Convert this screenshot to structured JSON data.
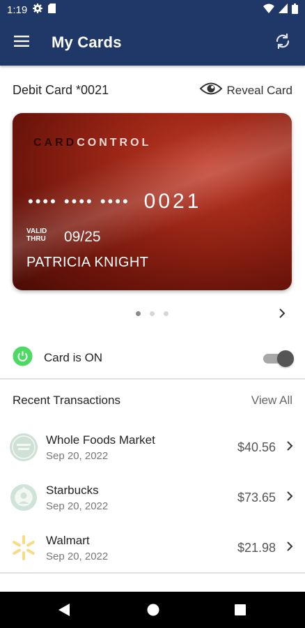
{
  "status_bar": {
    "time": "1:19",
    "icons": [
      "gear-icon",
      "sd-card-icon",
      "wifi-icon",
      "signal-icon",
      "battery-icon"
    ]
  },
  "app_bar": {
    "title": "My Cards",
    "background": "#1f3868",
    "icons": [
      "menu-icon",
      "refresh-icon"
    ]
  },
  "card_section": {
    "card_name": "Debit Card *0021",
    "reveal_label": "Reveal Card",
    "card": {
      "brand_part1": "CARD",
      "brand_part2": "CONTROL",
      "masked_groups": "•••• •••• ••••",
      "last4": "0021",
      "valid_label_line1": "VALID",
      "valid_label_line2": "THRU",
      "expiry": "09/25",
      "holder": "PATRICIA KNIGHT",
      "color": "#8e2213"
    },
    "pager": {
      "pages": 3,
      "active": 0
    }
  },
  "card_status": {
    "label": "Card is ON",
    "on": true,
    "accent": "#4cd964"
  },
  "transactions": {
    "title": "Recent Transactions",
    "view_all": "View All",
    "items": [
      {
        "merchant": "Whole Foods Market",
        "date": "Sep 20, 2022",
        "amount": "$40.56",
        "icon": "whole-foods-logo"
      },
      {
        "merchant": "Starbucks",
        "date": "Sep 20, 2022",
        "amount": "$73.65",
        "icon": "starbucks-logo"
      },
      {
        "merchant": "Walmart",
        "date": "Sep 20, 2022",
        "amount": "$21.98",
        "icon": "walmart-logo"
      }
    ]
  },
  "nav_bar": {
    "icons": [
      "back-icon",
      "home-icon",
      "recents-icon"
    ]
  }
}
